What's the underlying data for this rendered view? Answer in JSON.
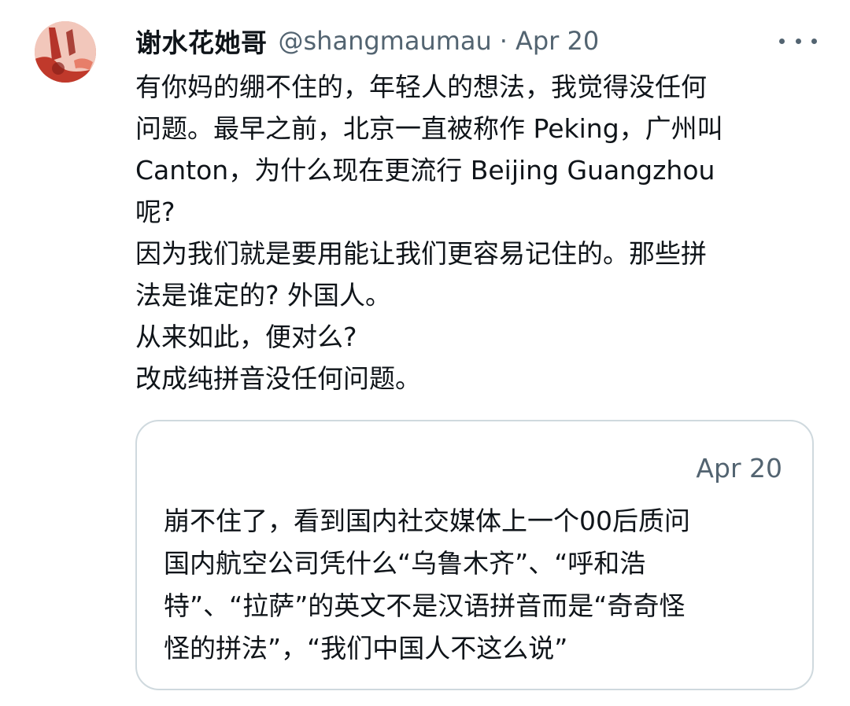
{
  "tweet": {
    "avatar_icon": "avatar-image",
    "display_name": "谢水花她哥",
    "handle": "@shangmaumau",
    "separator": "·",
    "date": "Apr 20",
    "more_icon": "more-options-icon",
    "lines": [
      "有你妈的绷不住的，年轻人的想法，我觉得没任何",
      "问题。最早之前，北京一直被称作 Peking，广州叫",
      "Canton，为什么现在更流行 Beijing Guangzhou",
      "呢?",
      "因为我们就是要用能让我们更容易记住的。那些拼",
      "法是谁定的? 外国人。",
      "从来如此，便对么?",
      "改成纯拼音没任何问题。"
    ]
  },
  "quoted_tweet": {
    "date": "Apr 20",
    "lines": [
      "崩不住了，看到国内社交媒体上一个00后质问",
      "国内航空公司凭什么“乌鲁木齐”、“呼和浩",
      "特”、“拉萨”的英文不是汉语拼音而是“奇奇怪",
      "怪的拼法”，“我们中国人不这么说”"
    ]
  },
  "colors": {
    "text_primary": "#0f1419",
    "text_secondary": "#536471",
    "border": "#cfd9de"
  }
}
